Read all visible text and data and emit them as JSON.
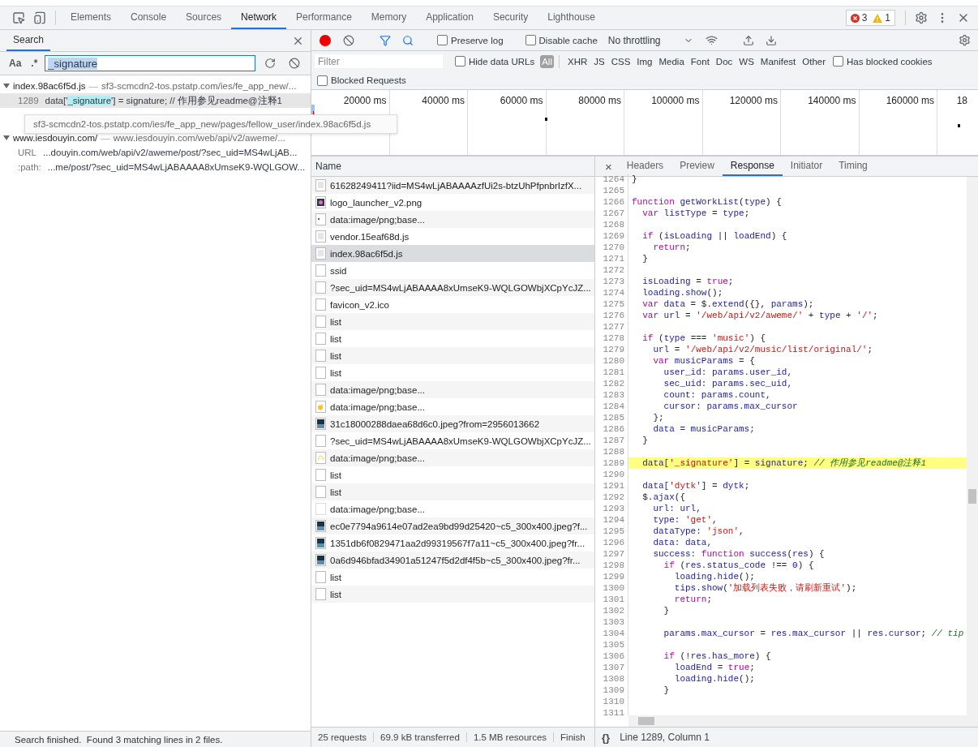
{
  "devtools_tabs": [
    {
      "label": "Elements",
      "selected": false
    },
    {
      "label": "Console",
      "selected": false
    },
    {
      "label": "Sources",
      "selected": false
    },
    {
      "label": "Network",
      "selected": true
    },
    {
      "label": "Performance",
      "selected": false
    },
    {
      "label": "Memory",
      "selected": false
    },
    {
      "label": "Application",
      "selected": false
    },
    {
      "label": "Security",
      "selected": false
    },
    {
      "label": "Lighthouse",
      "selected": false
    }
  ],
  "issues": {
    "errors": "3",
    "warnings": "1"
  },
  "search_panel": {
    "tab": "Search",
    "match_case": "Aa",
    "regex": ".*",
    "query": "_signature",
    "results": [
      {
        "file": "index.98ac6f5d.js",
        "separator": "—",
        "url": "sf3-scmcdn2-tos.pstatp.com/ies/fe_app_new/...",
        "expanded": true,
        "matches": [
          {
            "label": "1289",
            "text": "data['",
            "match": "_signature",
            "rest": "'] = signature; // 作用参见readme@注释1",
            "selected": true
          }
        ]
      },
      {
        "file": "www.iesdouyin.com/",
        "separator": "—",
        "url": "www.iesdouyin.com/web/api/v2/aweme/...",
        "expanded": true,
        "matches": [
          {
            "label": "URL",
            "text": "...douyin.com/web/api/v2/aweme/post/?sec_uid=MS4wLjAB...",
            "selected": false
          },
          {
            "label": ":path:",
            "text": "...me/post/?sec_uid=MS4wLjABAAAA8xUmseK9-WQLGOW...",
            "selected": false
          }
        ]
      }
    ],
    "tooltip": "sf3-scmcdn2-tos.pstatp.com/ies/fe_app_new/pages/fellow_user/index.98ac6f5d.js",
    "status": "Search finished.  Found 3 matching lines in 2 files."
  },
  "toolbar": {
    "recording": true,
    "preserve_log": {
      "label": "Preserve log",
      "checked": false
    },
    "disable_cache": {
      "label": "Disable cache",
      "checked": false
    },
    "throttling": "No throttling"
  },
  "filter_bar": {
    "placeholder": "Filter",
    "hide_data_urls": {
      "label": "Hide data URLs",
      "checked": false
    },
    "types": [
      {
        "label": "All",
        "selected": true
      },
      {
        "label": "XHR",
        "selected": false
      },
      {
        "label": "JS",
        "selected": false
      },
      {
        "label": "CSS",
        "selected": false
      },
      {
        "label": "Img",
        "selected": false
      },
      {
        "label": "Media",
        "selected": false
      },
      {
        "label": "Font",
        "selected": false
      },
      {
        "label": "Doc",
        "selected": false
      },
      {
        "label": "WS",
        "selected": false
      },
      {
        "label": "Manifest",
        "selected": false
      },
      {
        "label": "Other",
        "selected": false
      }
    ],
    "has_blocked_cookies": {
      "label": "Has blocked cookies",
      "checked": false
    },
    "blocked_requests": {
      "label": "Blocked Requests",
      "checked": false
    }
  },
  "timeline": {
    "ticks": [
      "20000 ms",
      "40000 ms",
      "60000 ms",
      "80000 ms",
      "100000 ms",
      "120000 ms",
      "140000 ms",
      "160000 ms",
      "18"
    ]
  },
  "requests": {
    "column": "Name",
    "rows": [
      {
        "name": "61628249411?iid=MS4wLjABAAAAzfUi2s-btzUhPfpnbrIzfX...",
        "kind": "script",
        "selected": false
      },
      {
        "name": "logo_launcher_v2.png",
        "kind": "logo",
        "selected": false
      },
      {
        "name": "data:image/png;base...",
        "kind": "dot",
        "selected": false
      },
      {
        "name": "vendor.15eaf68d.js",
        "kind": "script",
        "selected": false
      },
      {
        "name": "index.98ac6f5d.js",
        "kind": "script",
        "selected": true
      },
      {
        "name": "ssid",
        "kind": "blank",
        "selected": false
      },
      {
        "name": "?sec_uid=MS4wLjABAAAA8xUmseK9-WQLGOWbjXCpYcJZ...",
        "kind": "blank",
        "selected": false
      },
      {
        "name": "favicon_v2.ico",
        "kind": "blank",
        "selected": false
      },
      {
        "name": "list",
        "kind": "blank",
        "selected": false
      },
      {
        "name": "list",
        "kind": "blank",
        "selected": false
      },
      {
        "name": "list",
        "kind": "blank",
        "selected": false
      },
      {
        "name": "list",
        "kind": "blank",
        "selected": false
      },
      {
        "name": "data:image/png;base...",
        "kind": "blank",
        "selected": false
      },
      {
        "name": "data:image/png;base...",
        "kind": "note",
        "selected": false
      },
      {
        "name": "31c18000288daea68d6c0.jpeg?from=2956013662",
        "kind": "photo",
        "selected": false
      },
      {
        "name": "?sec_uid=MS4wLjABAAAA8xUmseK9-WQLGOWbjXCpYcJZ...",
        "kind": "blank",
        "selected": false
      },
      {
        "name": "data:image/png;base...",
        "kind": "ring",
        "selected": false
      },
      {
        "name": "list",
        "kind": "blank",
        "selected": false
      },
      {
        "name": "list",
        "kind": "blank",
        "selected": false
      },
      {
        "name": "data:image/png;base...",
        "kind": "faint",
        "selected": false
      },
      {
        "name": "ec0e7794a9614e07ad2ea9bd99d25420~c5_300x400.jpeg?f...",
        "kind": "photo",
        "selected": false
      },
      {
        "name": "1351db6f0829471aa2d99319567f7a11~c5_300x400.jpeg?fr...",
        "kind": "photo",
        "selected": false
      },
      {
        "name": "0a6d946bfad34901a51247f5d2df4f5b~c5_300x400.jpeg?fr...",
        "kind": "photo",
        "selected": false
      },
      {
        "name": "list",
        "kind": "blank",
        "selected": false
      },
      {
        "name": "list",
        "kind": "blank",
        "selected": false
      }
    ],
    "summary": [
      "25 requests",
      "69.9 kB transferred",
      "1.5 MB resources",
      "Finish"
    ]
  },
  "detail": {
    "close": "×",
    "tabs": [
      {
        "label": "Headers",
        "selected": false
      },
      {
        "label": "Preview",
        "selected": false
      },
      {
        "label": "Response",
        "selected": true
      },
      {
        "label": "Initiator",
        "selected": false
      },
      {
        "label": "Timing",
        "selected": false
      }
    ],
    "code": [
      {
        "number": "1264",
        "highlighted": false,
        "tokens": [
          {
            "kind": "plain",
            "text": "}"
          }
        ]
      },
      {
        "number": "1265",
        "highlighted": false
      },
      {
        "number": "1266",
        "highlighted": false,
        "tokens": [
          {
            "kind": "keyword",
            "text": "function "
          },
          {
            "kind": "name",
            "text": "getWorkList"
          },
          {
            "kind": "plain",
            "text": "("
          },
          {
            "kind": "name",
            "text": "type"
          },
          {
            "kind": "plain",
            "text": ") {"
          }
        ]
      },
      {
        "number": "1267",
        "highlighted": false,
        "tokens": [
          {
            "kind": "keyword",
            "text": "  var "
          },
          {
            "kind": "name",
            "text": "listType"
          },
          {
            "kind": "plain",
            "text": " = "
          },
          {
            "kind": "name",
            "text": "type"
          },
          {
            "kind": "plain",
            "text": ";"
          }
        ]
      },
      {
        "number": "1268",
        "highlighted": false
      },
      {
        "number": "1269",
        "highlighted": false,
        "tokens": [
          {
            "kind": "keyword",
            "text": "  if "
          },
          {
            "kind": "plain",
            "text": "("
          },
          {
            "kind": "name",
            "text": "isLoading"
          },
          {
            "kind": "plain",
            "text": " || "
          },
          {
            "kind": "name",
            "text": "loadEnd"
          },
          {
            "kind": "plain",
            "text": ") {"
          }
        ]
      },
      {
        "number": "1270",
        "highlighted": false,
        "tokens": [
          {
            "kind": "keyword",
            "text": "    return"
          },
          {
            "kind": "plain",
            "text": ";"
          }
        ]
      },
      {
        "number": "1271",
        "highlighted": false,
        "tokens": [
          {
            "kind": "plain",
            "text": "  }"
          }
        ]
      },
      {
        "number": "1272",
        "highlighted": false
      },
      {
        "number": "1273",
        "highlighted": false,
        "tokens": [
          {
            "kind": "name",
            "text": "  isLoading"
          },
          {
            "kind": "plain",
            "text": " = "
          },
          {
            "kind": "keyword",
            "text": "true"
          },
          {
            "kind": "plain",
            "text": ";"
          }
        ]
      },
      {
        "number": "1274",
        "highlighted": false,
        "tokens": [
          {
            "kind": "name",
            "text": "  loading"
          },
          {
            "kind": "plain",
            "text": "."
          },
          {
            "kind": "name",
            "text": "show"
          },
          {
            "kind": "plain",
            "text": "();"
          }
        ]
      },
      {
        "number": "1275",
        "highlighted": false,
        "tokens": [
          {
            "kind": "keyword",
            "text": "  var "
          },
          {
            "kind": "name",
            "text": "data"
          },
          {
            "kind": "plain",
            "text": " = $."
          },
          {
            "kind": "name",
            "text": "extend"
          },
          {
            "kind": "plain",
            "text": "({}, "
          },
          {
            "kind": "name",
            "text": "params"
          },
          {
            "kind": "plain",
            "text": ");"
          }
        ]
      },
      {
        "number": "1276",
        "highlighted": false,
        "tokens": [
          {
            "kind": "keyword",
            "text": "  var "
          },
          {
            "kind": "name",
            "text": "url"
          },
          {
            "kind": "plain",
            "text": " = "
          },
          {
            "kind": "string",
            "text": "'/web/api/v2/aweme/'"
          },
          {
            "kind": "plain",
            "text": " + "
          },
          {
            "kind": "name",
            "text": "type"
          },
          {
            "kind": "plain",
            "text": " + "
          },
          {
            "kind": "string",
            "text": "'/'"
          },
          {
            "kind": "plain",
            "text": ";"
          }
        ]
      },
      {
        "number": "1277",
        "highlighted": false
      },
      {
        "number": "1278",
        "highlighted": false,
        "tokens": [
          {
            "kind": "keyword",
            "text": "  if "
          },
          {
            "kind": "plain",
            "text": "("
          },
          {
            "kind": "name",
            "text": "type"
          },
          {
            "kind": "plain",
            "text": " === "
          },
          {
            "kind": "string",
            "text": "'music'"
          },
          {
            "kind": "plain",
            "text": ") {"
          }
        ]
      },
      {
        "number": "1279",
        "highlighted": false,
        "tokens": [
          {
            "kind": "name",
            "text": "    url"
          },
          {
            "kind": "plain",
            "text": " = "
          },
          {
            "kind": "string",
            "text": "'/web/api/v2/music/list/original/'"
          },
          {
            "kind": "plain",
            "text": ";"
          }
        ]
      },
      {
        "number": "1280",
        "highlighted": false,
        "tokens": [
          {
            "kind": "keyword",
            "text": "    var "
          },
          {
            "kind": "name",
            "text": "musicParams"
          },
          {
            "kind": "plain",
            "text": " = {"
          }
        ]
      },
      {
        "number": "1281",
        "highlighted": false,
        "tokens": [
          {
            "kind": "name",
            "text": "      user_id: params.user_id,"
          }
        ]
      },
      {
        "number": "1282",
        "highlighted": false,
        "tokens": [
          {
            "kind": "name",
            "text": "      sec_uid: params.sec_uid,"
          }
        ]
      },
      {
        "number": "1283",
        "highlighted": false,
        "tokens": [
          {
            "kind": "name",
            "text": "      count: params.count,"
          }
        ]
      },
      {
        "number": "1284",
        "highlighted": false,
        "tokens": [
          {
            "kind": "name",
            "text": "      cursor: params.max_cursor"
          }
        ]
      },
      {
        "number": "1285",
        "highlighted": false,
        "tokens": [
          {
            "kind": "plain",
            "text": "    };"
          }
        ]
      },
      {
        "number": "1286",
        "highlighted": false,
        "tokens": [
          {
            "kind": "name",
            "text": "    data = musicParams;"
          }
        ]
      },
      {
        "number": "1287",
        "highlighted": false,
        "tokens": [
          {
            "kind": "plain",
            "text": "  }"
          }
        ]
      },
      {
        "number": "1288",
        "highlighted": false
      },
      {
        "number": "1289",
        "highlighted": true,
        "tokens": [
          {
            "kind": "name",
            "text": "  data["
          },
          {
            "kind": "string",
            "text": "'_signature'"
          },
          {
            "kind": "plain",
            "text": "] = "
          },
          {
            "kind": "name",
            "text": "signature"
          },
          {
            "kind": "plain",
            "text": "; "
          },
          {
            "kind": "comment",
            "text": "// 作用参见readme@注释1"
          }
        ]
      },
      {
        "number": "1290",
        "highlighted": false
      },
      {
        "number": "1291",
        "highlighted": false,
        "tokens": [
          {
            "kind": "name",
            "text": "  data["
          },
          {
            "kind": "string",
            "text": "'dytk'"
          },
          {
            "kind": "plain",
            "text": "] = "
          },
          {
            "kind": "name",
            "text": "dytk"
          },
          {
            "kind": "plain",
            "text": ";"
          }
        ]
      },
      {
        "number": "1292",
        "highlighted": false,
        "tokens": [
          {
            "kind": "plain",
            "text": "  $."
          },
          {
            "kind": "name",
            "text": "ajax"
          },
          {
            "kind": "plain",
            "text": "({"
          }
        ]
      },
      {
        "number": "1293",
        "highlighted": false,
        "tokens": [
          {
            "kind": "name",
            "text": "    url: url,"
          }
        ]
      },
      {
        "number": "1294",
        "highlighted": false,
        "tokens": [
          {
            "kind": "name",
            "text": "    type: "
          },
          {
            "kind": "string",
            "text": "'get'"
          },
          {
            "kind": "plain",
            "text": ","
          }
        ]
      },
      {
        "number": "1295",
        "highlighted": false,
        "tokens": [
          {
            "kind": "name",
            "text": "    dataType: "
          },
          {
            "kind": "string",
            "text": "'json'"
          },
          {
            "kind": "plain",
            "text": ","
          }
        ]
      },
      {
        "number": "1296",
        "highlighted": false,
        "tokens": [
          {
            "kind": "name",
            "text": "    data: data,"
          }
        ]
      },
      {
        "number": "1297",
        "highlighted": false,
        "tokens": [
          {
            "kind": "name",
            "text": "    success: "
          },
          {
            "kind": "keyword",
            "text": "function "
          },
          {
            "kind": "name",
            "text": "success"
          },
          {
            "kind": "plain",
            "text": "("
          },
          {
            "kind": "name",
            "text": "res"
          },
          {
            "kind": "plain",
            "text": ") {"
          }
        ]
      },
      {
        "number": "1298",
        "highlighted": false,
        "tokens": [
          {
            "kind": "keyword",
            "text": "      if "
          },
          {
            "kind": "plain",
            "text": "("
          },
          {
            "kind": "name",
            "text": "res.status_code"
          },
          {
            "kind": "plain",
            "text": " !== "
          },
          {
            "kind": "number",
            "text": "0"
          },
          {
            "kind": "plain",
            "text": ") {"
          }
        ]
      },
      {
        "number": "1299",
        "highlighted": false,
        "tokens": [
          {
            "kind": "name",
            "text": "        loading.hide"
          },
          {
            "kind": "plain",
            "text": "();"
          }
        ]
      },
      {
        "number": "1300",
        "highlighted": false,
        "tokens": [
          {
            "kind": "name",
            "text": "        tips.show"
          },
          {
            "kind": "plain",
            "text": "("
          },
          {
            "kind": "string",
            "text": "'加载列表失败，请刷新重试'"
          },
          {
            "kind": "plain",
            "text": ");"
          }
        ]
      },
      {
        "number": "1301",
        "highlighted": false,
        "tokens": [
          {
            "kind": "keyword",
            "text": "        return"
          },
          {
            "kind": "plain",
            "text": ";"
          }
        ]
      },
      {
        "number": "1302",
        "highlighted": false,
        "tokens": [
          {
            "kind": "plain",
            "text": "      }"
          }
        ]
      },
      {
        "number": "1303",
        "highlighted": false
      },
      {
        "number": "1304",
        "highlighted": false,
        "tokens": [
          {
            "kind": "name",
            "text": "      params.max_cursor = res.max_cursor "
          },
          {
            "kind": "plain",
            "text": "|| "
          },
          {
            "kind": "name",
            "text": "res.cursor"
          },
          {
            "kind": "plain",
            "text": "; "
          },
          {
            "kind": "comment",
            "text": "// tip"
          }
        ]
      },
      {
        "number": "1305",
        "highlighted": false
      },
      {
        "number": "1306",
        "highlighted": false,
        "tokens": [
          {
            "kind": "keyword",
            "text": "      if "
          },
          {
            "kind": "plain",
            "text": "(!"
          },
          {
            "kind": "name",
            "text": "res.has_more"
          },
          {
            "kind": "plain",
            "text": ") {"
          }
        ]
      },
      {
        "number": "1307",
        "highlighted": false,
        "tokens": [
          {
            "kind": "name",
            "text": "        loadEnd"
          },
          {
            "kind": "plain",
            "text": " = "
          },
          {
            "kind": "keyword",
            "text": "true"
          },
          {
            "kind": "plain",
            "text": ";"
          }
        ]
      },
      {
        "number": "1308",
        "highlighted": false,
        "tokens": [
          {
            "kind": "name",
            "text": "        loading.hide"
          },
          {
            "kind": "plain",
            "text": "();"
          }
        ]
      },
      {
        "number": "1309",
        "highlighted": false,
        "tokens": [
          {
            "kind": "plain",
            "text": "      }"
          }
        ]
      },
      {
        "number": "1310",
        "highlighted": false
      },
      {
        "number": "1311",
        "highlighted": false
      }
    ],
    "format": "{}",
    "position": "Line 1289, Column 1"
  }
}
